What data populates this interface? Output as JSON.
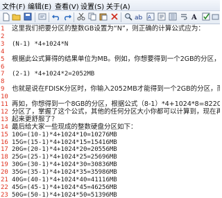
{
  "menu": {
    "file": "文件(F)",
    "edit": "编辑(E)",
    "view": "查看(V)",
    "settings": "设置(S)",
    "about": "关于(A)"
  },
  "toolbar_icons": [
    "new-file-icon",
    "open-folder-icon",
    "save-icon",
    "cut-icon",
    "undo-icon",
    "redo-icon",
    "copy-icon",
    "paste-icon",
    "delete-icon",
    "find-icon",
    "replace-icon",
    "hex-icon",
    "insert-icon",
    "format-icon",
    "word-wrap-icon",
    "font-icon",
    "settings-icon"
  ],
  "lines": [
    {
      "n": "1",
      "t": "这里我们把要分区的整数GB设置为“N”，则正确的计算公式应为："
    },
    {
      "n": "2",
      "t": ""
    },
    {
      "n": "3",
      "t": "(N-1) *4+1024*N",
      "mono": true
    },
    {
      "n": "4",
      "t": ""
    },
    {
      "n": "5",
      "t": "根据此公式算得的结果单位为MB。例如，你想要得到一个2GB的分区，套用公"
    },
    {
      "n": "6",
      "t": ""
    },
    {
      "n": "7",
      "t": "(2-1) *4+1024*2=2052MB",
      "mono": true
    },
    {
      "n": "8",
      "t": ""
    },
    {
      "n": "9",
      "t": "也就是说在FDISK分区时，你输入2052MB才能得到一个2GB的分区，而我们通"
    },
    {
      "n": "10",
      "t": ""
    },
    {
      "n": "11",
      "t": "再如，你想得到一个8GB的分区，根据公式（8-1）*4+1024*8=8220MB，你"
    },
    {
      "n": "12",
      "t": "分区了，掌握了这个公式，其他的任何分区大小你都可以计算到，现在再看"
    },
    {
      "n": "13",
      "t": "起来更舒服了？"
    },
    {
      "n": "14",
      "t": "最后给大家一些现成的整数硬盘分区如下："
    },
    {
      "n": "15",
      "t": "10G=(10-1)*4+1024*10=10276MB",
      "mono": true
    },
    {
      "n": "16",
      "t": "15G=(15-1)*4+1024*15=15416MB",
      "mono": true
    },
    {
      "n": "17",
      "t": "20G=(20-1)*4+1024*20=20556MB",
      "mono": true
    },
    {
      "n": "18",
      "t": "25G=(25-1)*4+1024*25=25696MB",
      "mono": true
    },
    {
      "n": "19",
      "t": "30G=(30-1)*4+1024*30=30836MB",
      "mono": true
    },
    {
      "n": "20",
      "t": "35G=(35-1)*4+1024*35=35986MB",
      "mono": true
    },
    {
      "n": "21",
      "t": "40G=(40-1)*4+1024*40=41116MB",
      "mono": true
    },
    {
      "n": "22",
      "t": "45G=(45-1)*4+1024*45=46256MB",
      "mono": true
    },
    {
      "n": "23",
      "t": "50G=(50-1)*4+1024*50=51396MB",
      "mono": true
    }
  ]
}
